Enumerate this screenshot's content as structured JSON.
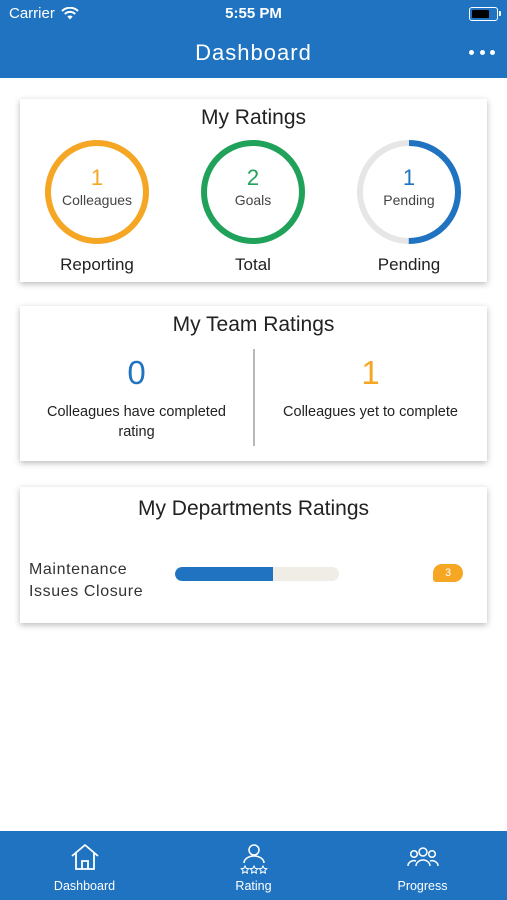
{
  "status_bar": {
    "carrier": "Carrier",
    "time": "5:55 PM"
  },
  "header": {
    "title": "Dashboard",
    "more_icon": "more-dots-icon"
  },
  "my_ratings": {
    "title": "My Ratings",
    "rings": [
      {
        "value": "1",
        "sub": "Colleagues",
        "label": "Reporting",
        "color": "#f5a623",
        "fraction": 1.0
      },
      {
        "value": "2",
        "sub": "Goals",
        "label": "Total",
        "color": "#21a25a",
        "fraction": 1.0
      },
      {
        "value": "1",
        "sub": "Pending",
        "label": "Pending",
        "color": "#1f73c0",
        "fraction": 0.5
      }
    ]
  },
  "team_ratings": {
    "title": "My Team Ratings",
    "completed": {
      "value": "0",
      "desc": "Colleagues have completed rating",
      "color": "#1f73c0"
    },
    "pending": {
      "value": "1",
      "desc": "Colleagues yet to complete",
      "color": "#f5a623"
    }
  },
  "department_ratings": {
    "title": "My Departments Ratings",
    "items": [
      {
        "label_line1": "Maintenance",
        "label_line2": "Issues Closure",
        "progress": 0.6,
        "badge": "3"
      }
    ]
  },
  "tabbar": {
    "tabs": [
      {
        "label": "Dashboard",
        "icon": "home-icon"
      },
      {
        "label": "Rating",
        "icon": "rating-user-icon"
      },
      {
        "label": "Progress",
        "icon": "group-icon"
      }
    ]
  },
  "colors": {
    "primary": "#1f73c0",
    "orange": "#f5a623",
    "green": "#21a25a",
    "track": "#e6e6e6"
  }
}
